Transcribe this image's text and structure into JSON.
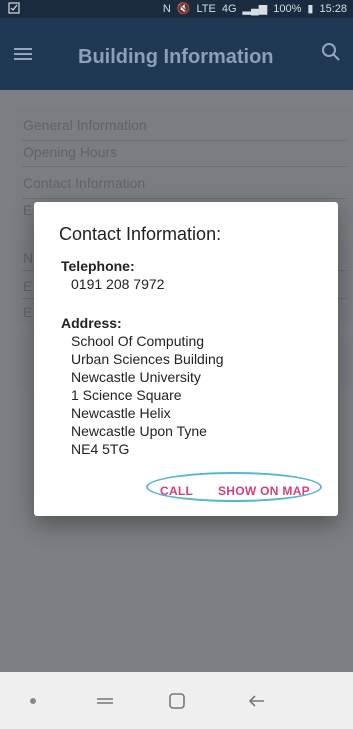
{
  "status_bar": {
    "left_icon": "notification-icon",
    "nfc": "N",
    "mute": "mute",
    "network": "LTE",
    "signal": "4G",
    "battery": "100%",
    "time": "15:28"
  },
  "app_bar": {
    "title": "Building Information",
    "menu_icon": "menu-icon",
    "search_icon": "search-icon"
  },
  "background_list": {
    "items": [
      "General Information",
      "Opening Hours",
      "Contact Information",
      "E"
    ],
    "card2": [
      "N",
      "E",
      "E"
    ]
  },
  "dialog": {
    "title": "Contact Information:",
    "telephone_label": "Telephone:",
    "telephone_value": "0191 208 7972",
    "address_label": "Address:",
    "address_lines": [
      "School Of Computing",
      "Urban Sciences Building",
      "Newcastle University",
      "1 Science Square",
      "Newcastle Helix",
      "Newcastle Upon Tyne",
      "NE4 5TG"
    ],
    "call_label": "CALL",
    "map_label": "SHOW ON MAP"
  },
  "nav_bar": {
    "icons": [
      "dot-icon",
      "recent-apps-icon",
      "home-icon",
      "back-icon"
    ]
  }
}
